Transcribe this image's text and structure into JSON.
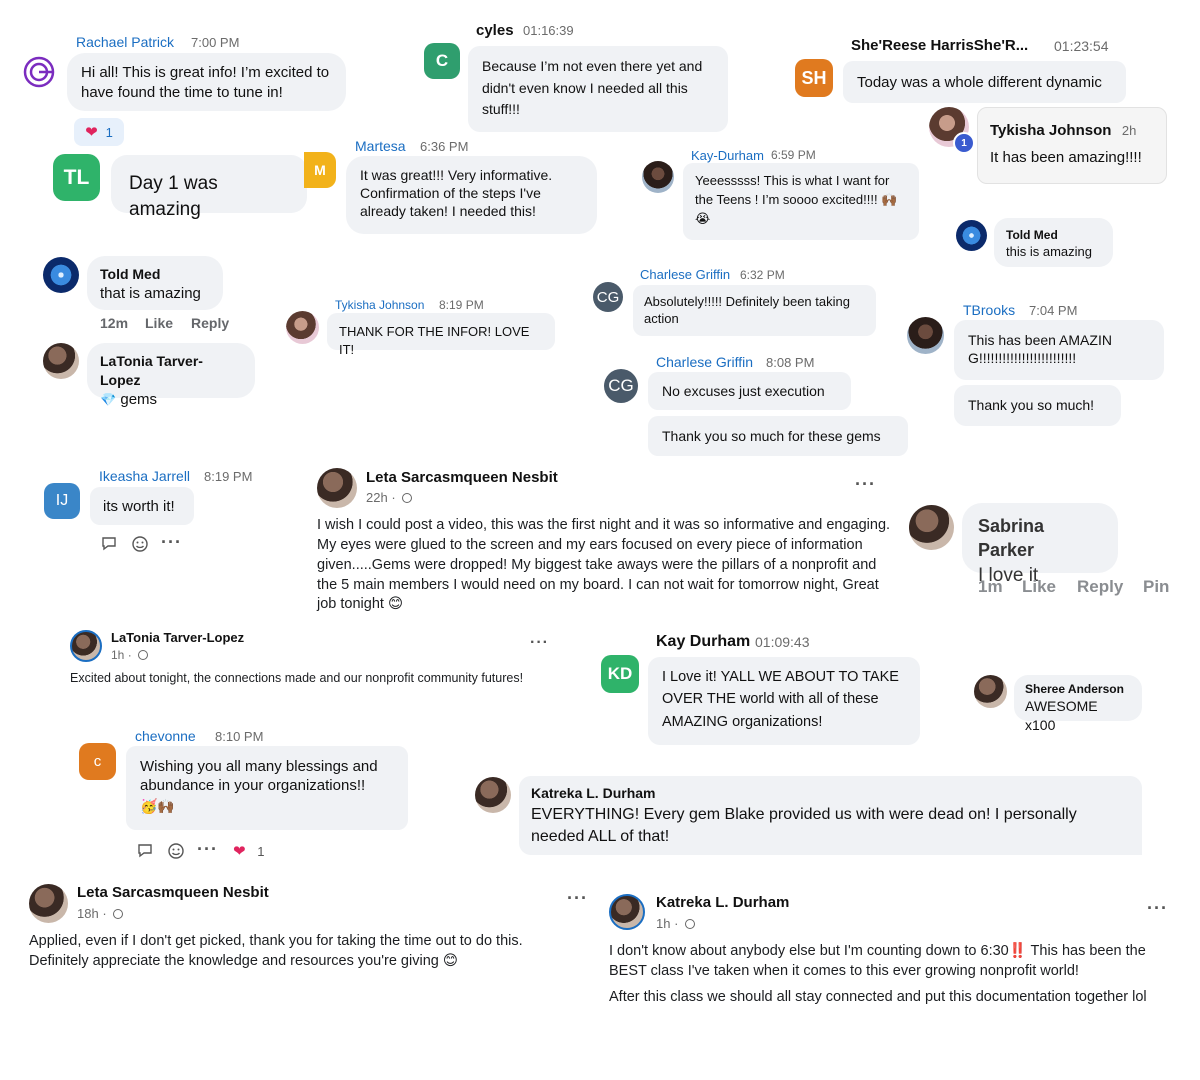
{
  "c1": {
    "name": "Rachael Patrick",
    "time": "7:00 PM",
    "text": "Hi all! This is great info! I’m excited to have found the time to tune in!",
    "reaction_count": "1",
    "reaction_icon": "heart-icon"
  },
  "c2": {
    "name": "cyles",
    "time": "01:16:39",
    "avatar": "C",
    "text": "Because I’m not even there yet and didn't even know I needed all this stuff!!!"
  },
  "c3": {
    "name": "She'Reese HarrisShe'R...",
    "time": "01:23:54",
    "avatar": "SH",
    "text": "Today was a whole different dynamic"
  },
  "c4": {
    "name": "Tykisha Johnson",
    "time": "2h",
    "badge": "1",
    "text": "It has been amazing!!!!"
  },
  "c5": {
    "avatar": "TL",
    "text": "Day 1 was amazing"
  },
  "c6": {
    "name": "Martesa",
    "time": "6:36 PM",
    "avatar": "M",
    "text": "It was great!!! Very informative. Confirmation of the steps I've already taken! I needed this!"
  },
  "c7": {
    "name": "Kay-Durham",
    "time": "6:59 PM",
    "text": "Yeeesssss! This is what I want for the Teens ! I’m soooo excited!!!! 🙌🏾 😭"
  },
  "c8": {
    "name": "Told Med",
    "text": "this is amazing"
  },
  "c9": {
    "name": "Told Med",
    "text": "that is amazing",
    "time": "12m",
    "like": "Like",
    "reply": "Reply"
  },
  "c10": {
    "name": "LaTonia Tarver-Lopez",
    "text": "gems",
    "gem": "💎"
  },
  "c11": {
    "name": "Tykisha Johnson",
    "time": "8:19 PM",
    "text": "THANK FOR THE INFOR! LOVE IT!"
  },
  "c12": {
    "name": "Charlese Griffin",
    "time": "6:32 PM",
    "avatar": "CG",
    "text": "Absolutely!!!!! Definitely been taking action"
  },
  "c13": {
    "name": "TBrooks",
    "time": "7:04 PM",
    "text1": "This has been AMAZING!!!!!!!!!!!!!!!!!!!!!!!!!",
    "text2": "Thank you so much!"
  },
  "c14": {
    "name": "Charlese Griffin",
    "time": "8:08 PM",
    "avatar": "CG",
    "text1": "No excuses just execution",
    "text2": "Thank you so much for these gems"
  },
  "c15": {
    "name": "Ikeasha Jarrell",
    "time": "8:19 PM",
    "avatar": "IJ",
    "text": "its worth it!"
  },
  "c16": {
    "name": "Leta Sarcasmqueen Nesbit",
    "time": "22h",
    "text": "I wish I could post a video, this was the first night and it was so informative and engaging. My eyes were glued to the screen and my ears focused on every piece of information given.....Gems were dropped! My biggest take aways were the pillars of a nonprofit and the 5 main members I would need on my board. I can not wait for tomorrow night, Great job tonight 😊"
  },
  "c17": {
    "name": "Sabrina Parker",
    "text": "I love it",
    "time": "1m",
    "like": "Like",
    "reply": "Reply",
    "pin": "Pin"
  },
  "c18": {
    "name": "LaTonia Tarver-Lopez",
    "time": "1h",
    "text": "Excited about tonight, the connections made and our nonprofit community futures!"
  },
  "c19": {
    "name": "Kay Durham",
    "time": "01:09:43",
    "avatar": "KD",
    "text": "I Love it! YALL WE ABOUT TO TAKE OVER THE world with all of these AMAZING organizations!"
  },
  "c20": {
    "name": "Sheree Anderson",
    "text": "AWESOME x100"
  },
  "c21": {
    "name": "chevonne",
    "time": "8:10 PM",
    "avatar": "c",
    "text": "Wishing you all many blessings and abundance in your organizations!!",
    "emoji": "🥳🙌🏾",
    "reaction_count": "1"
  },
  "c22": {
    "name": "Katreka L. Durham",
    "text": "EVERYTHING! Every gem Blake provided us with were dead on! I personally needed ALL of that!"
  },
  "c23": {
    "name": "Leta Sarcasmqueen Nesbit",
    "time": "18h",
    "text1": "Applied, even if I don't get picked, thank you for taking the time out to do this.",
    "text2": "Definitely appreciate the knowledge and resources you're giving 😊"
  },
  "c24": {
    "name": "Katreka L. Durham",
    "time": "1h",
    "text1": "I don't know about anybody else but I'm counting down to 6:30‼️ This has been the BEST class I've taken when it comes to this ever growing nonprofit world!",
    "text2": "After this class we should all stay connected and put this documentation together lol"
  },
  "colors": {
    "link": "#1b6ec2",
    "green": "#2f9e6e",
    "orange": "#e07a1f",
    "slate": "#4a5a6a",
    "blue": "#3a86c8",
    "bubble": "#f0f2f5"
  }
}
